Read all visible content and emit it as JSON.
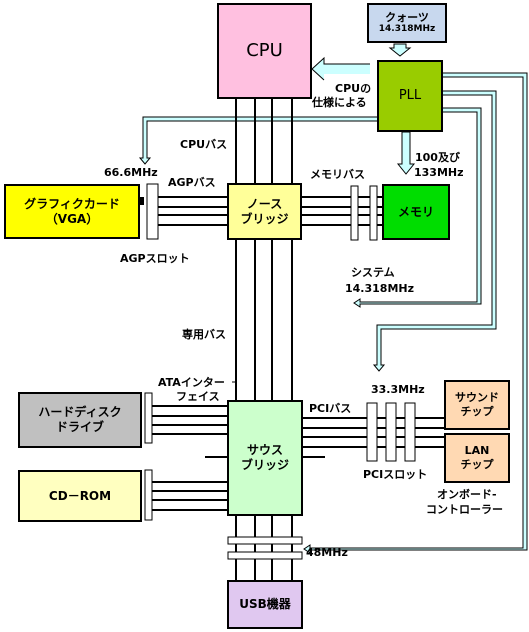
{
  "colors": {
    "cpu": "#ffc0e0",
    "quartz": "#c8d8ee",
    "pll": "#99cc00",
    "graphics": "#ffff00",
    "north_bridge": "#ffff99",
    "memory": "#00dd00",
    "hdd": "#c0c0c0",
    "cdrom": "#ffffc0",
    "south_bridge": "#ccffcc",
    "onboard_chip": "#ffd9b3",
    "usb": "#e0c8f0",
    "clock_line": "#ccffff"
  },
  "components": {
    "cpu": "CPU",
    "quartz": {
      "line1": "クォーツ",
      "line2": "14.318MHz"
    },
    "pll": "PLL",
    "graphics_card": {
      "line1": "グラフィクカード",
      "line2": "（VGA）"
    },
    "north_bridge": {
      "line1": "ノース",
      "line2": "ブリッジ"
    },
    "memory": "メモリ",
    "hdd": {
      "line1": "ハードディスク",
      "line2": "ドライブ"
    },
    "cdrom": "CD－ROM",
    "south_bridge": {
      "line1": "サウス",
      "line2": "ブリッジ"
    },
    "sound_chip": {
      "line1": "サウンド",
      "line2": "チップ"
    },
    "lan_chip": {
      "line1": "LAN",
      "line2": "チップ"
    },
    "usb": "USB機器"
  },
  "labels": {
    "cpu_spec_1": "CPUの",
    "cpu_spec_2": "仕様による",
    "cpu_bus": "CPUバス",
    "agp_freq": "66.6MHz",
    "agp_bus": "AGPバス",
    "agp_slot": "AGPスロット",
    "memory_bus": "メモリバス",
    "memory_freq_1": "100及び",
    "memory_freq_2": "133MHz",
    "system_1": "システム",
    "system_2": "14.318MHz",
    "dedicated_bus": "専用バス",
    "ata_1": "ATAインター",
    "ata_2": "フェイス",
    "pci_freq": "33.3MHz",
    "pci_bus": "PCIバス",
    "pci_slot": "PCIスロット",
    "onboard_1": "オンボード-",
    "onboard_2": "コントローラー",
    "usb_freq": "48MHz"
  }
}
